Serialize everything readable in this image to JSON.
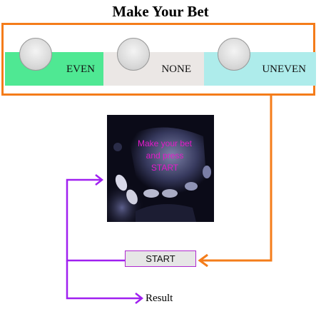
{
  "title": "Make Your Bet",
  "colors": {
    "frame": "#f47c1a",
    "flow": "#a020f0",
    "even_bg": "#4fe893",
    "none_bg": "#ebe7e5",
    "uneven_bg": "#aeeceb",
    "dice_text": "#e21ac8"
  },
  "options": [
    {
      "label": "EVEN"
    },
    {
      "label": "NONE"
    },
    {
      "label": "UNEVEN"
    }
  ],
  "dice": {
    "message_lines": [
      "Make your bet",
      "and press",
      "START"
    ]
  },
  "start_button": {
    "label": "START"
  },
  "result": {
    "label": "Result"
  }
}
